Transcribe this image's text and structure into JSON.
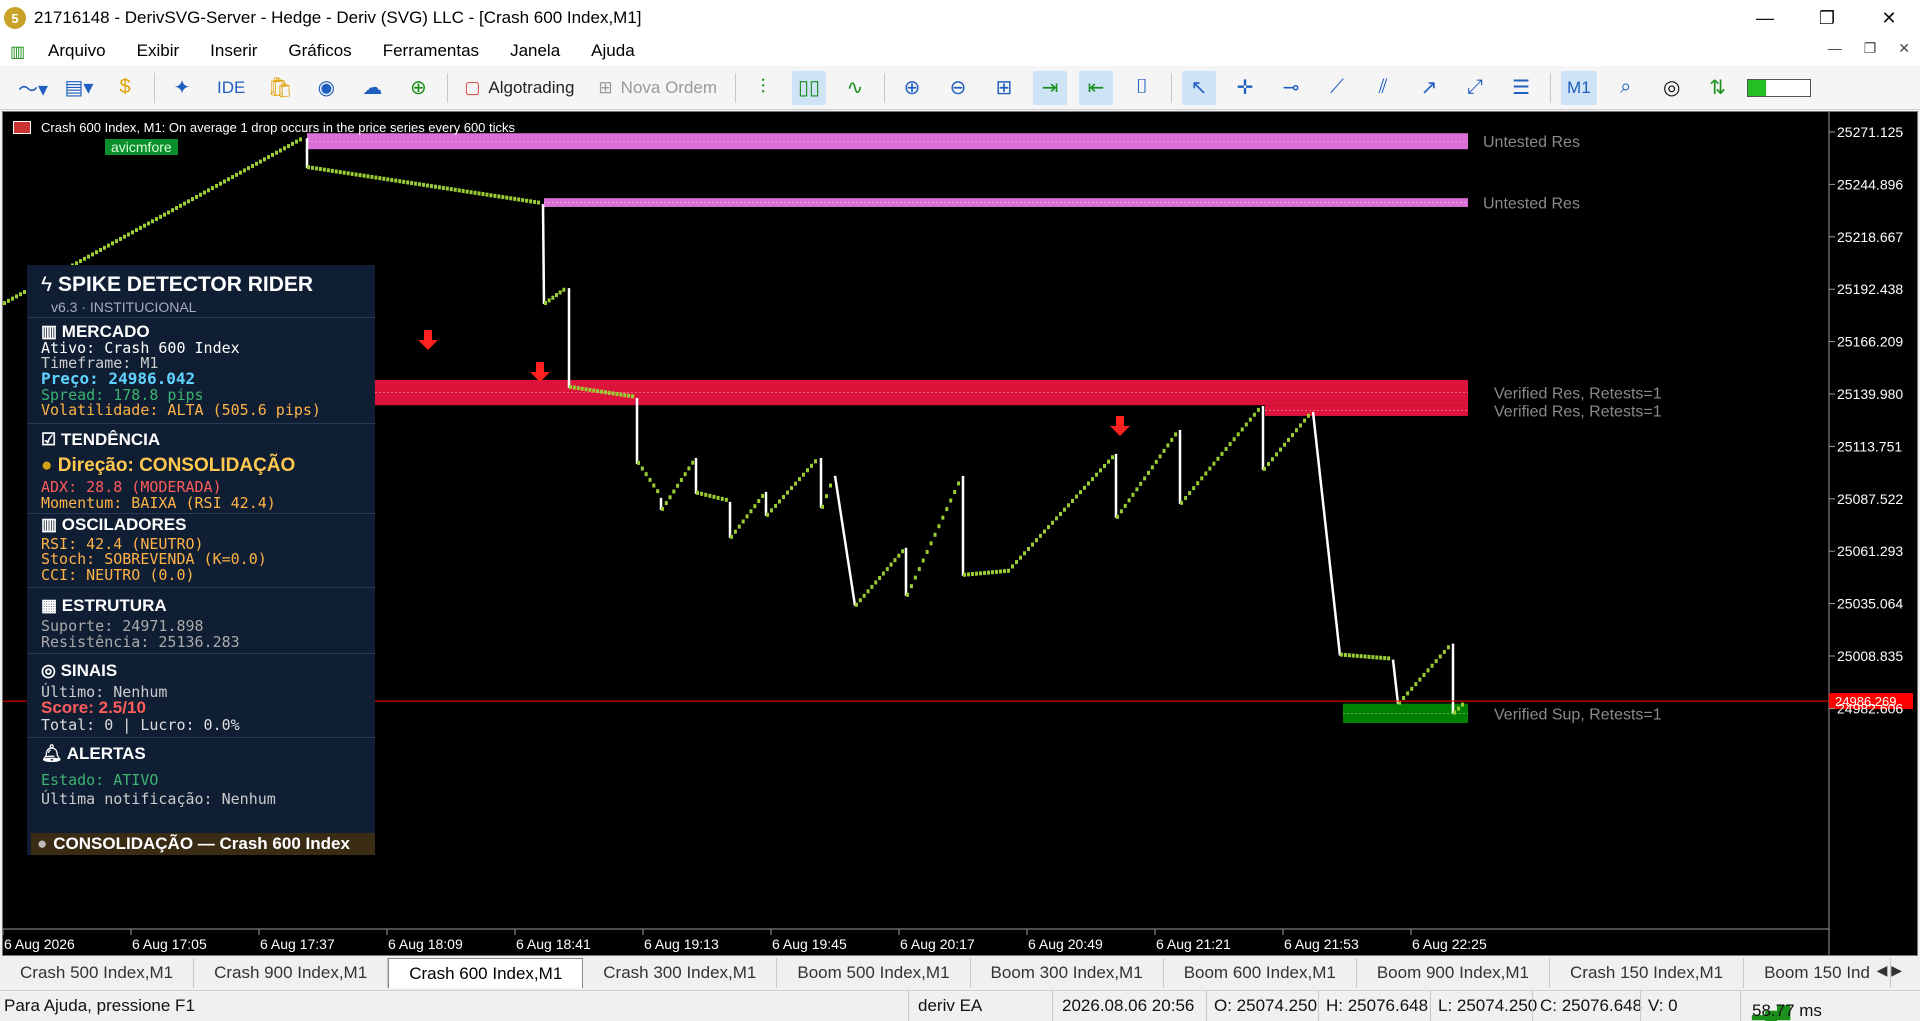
{
  "window": {
    "title": "21716148 - DerivSVG-Server - Hedge - Deriv (SVG) LLC - [Crash 600 Index,M1]"
  },
  "menu": {
    "items": [
      "Arquivo",
      "Exibir",
      "Inserir",
      "Gráficos",
      "Ferramentas",
      "Janela",
      "Ajuda"
    ]
  },
  "toolbar": {
    "ide_label": "IDE",
    "algotrading_label": "Algotrading",
    "new_order_label": "Nova Ordem",
    "timeframe_label": "M1"
  },
  "chart": {
    "header": "Crash 600 Index, M1:  On average 1 drop occurs in the price series every 600 ticks",
    "ea_tag": "avicmfore",
    "current_price_label": "24986.269",
    "zone_labels": [
      "Untested Res",
      "Untested Res",
      "Verified Res, Retests=1",
      "Verified Res, Retests=1",
      "Verified Sup, Retests=1"
    ],
    "price_ticks": [
      "25271.125",
      "25244.896",
      "25218.667",
      "25192.438",
      "25166.209",
      "25139.980",
      "25113.751",
      "25087.522",
      "25061.293",
      "25035.064",
      "25008.835",
      "24982.606"
    ],
    "time_ticks": [
      "6 Aug 2026",
      "6 Aug 17:05",
      "6 Aug 17:37",
      "6 Aug 18:09",
      "6 Aug 18:41",
      "6 Aug 19:13",
      "6 Aug 19:45",
      "6 Aug 20:17",
      "6 Aug 20:49",
      "6 Aug 21:21",
      "6 Aug 21:53",
      "6 Aug 22:25"
    ]
  },
  "panel": {
    "title": "SPIKE DETECTOR RIDER",
    "version": "v6.3 · INSTITUCIONAL",
    "mercado": {
      "heading": "MERCADO",
      "ativo": "Ativo: Crash 600 Index",
      "timeframe": "Timeframe: M1",
      "preco": "Preço: 24986.042",
      "spread": "Spread: 178.8 pips",
      "volatilidade": "Volatilidade: ALTA (505.6 pips)"
    },
    "tendencia": {
      "heading": "TENDÊNCIA",
      "direcao": "Direção: CONSOLIDAÇÃO",
      "adx": "ADX: 28.8 (MODERADA)",
      "momentum": "Momentum: BAIXA (RSI 42.4)"
    },
    "osciladores": {
      "heading": "OSCILADORES",
      "rsi": "RSI: 42.4 (NEUTRO)",
      "stoch": "Stoch: SOBREVENDA (K=0.0)",
      "cci": "CCI: NEUTRO (0.0)"
    },
    "estrutura": {
      "heading": "ESTRUTURA",
      "suporte": "Suporte: 24971.898",
      "resistencia": "Resistência: 25136.283"
    },
    "sinais": {
      "heading": "SINAIS",
      "ultimo": "Último: Nenhum",
      "score": "Score: 2.5/10",
      "total": "Total: 0 | Lucro: 0.0%"
    },
    "alertas": {
      "heading": "ALERTAS",
      "estado": "Estado: ATIVO",
      "ultima": "Última notificação: Nenhum"
    },
    "footer": "CONSOLIDAÇÃO — Crash 600 Index"
  },
  "tabs": [
    "Crash 500 Index,M1",
    "Crash 900 Index,M1",
    "Crash 600 Index,M1",
    "Crash 300 Index,M1",
    "Boom 500 Index,M1",
    "Boom 300 Index,M1",
    "Boom 600 Index,M1",
    "Boom 900 Index,M1",
    "Crash 150 Index,M1",
    "Boom 150 Ind"
  ],
  "status": {
    "help": "Para Ajuda, pressione F1",
    "ea": "deriv EA",
    "datetime": "2026.08.06 20:56",
    "open": "O: 25074.250",
    "high": "H: 25076.648",
    "low": "L: 25074.250",
    "close": "C: 25076.648",
    "volume": "V: 0",
    "ping": "58.77 ms"
  },
  "colors": {
    "candle_up": "#9acd32",
    "candle_down": "#ffffff",
    "untested_res": "#da70d6",
    "verified_res": "#dc143c",
    "verified_sup": "#008000",
    "price_line": "#ff0000"
  }
}
